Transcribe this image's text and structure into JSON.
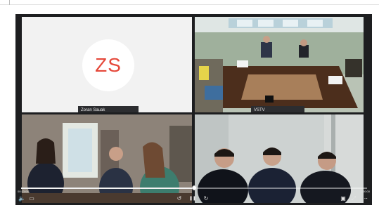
{
  "participants": [
    {
      "initials": "ZS",
      "name": "Zoran Sauak",
      "accent": "#e5483a"
    },
    {
      "name": "VSTV"
    }
  ],
  "player": {
    "elapsed": "00:13:04",
    "duration": "1:00:00",
    "progress_fraction": 0.5
  },
  "icons": {
    "volume": "🔈",
    "subtitles": "▭",
    "rewind": "↺",
    "pause": "❚❚",
    "forward": "↻",
    "pip": "▣",
    "fullscreen": "⤢",
    "more": "⋯"
  }
}
